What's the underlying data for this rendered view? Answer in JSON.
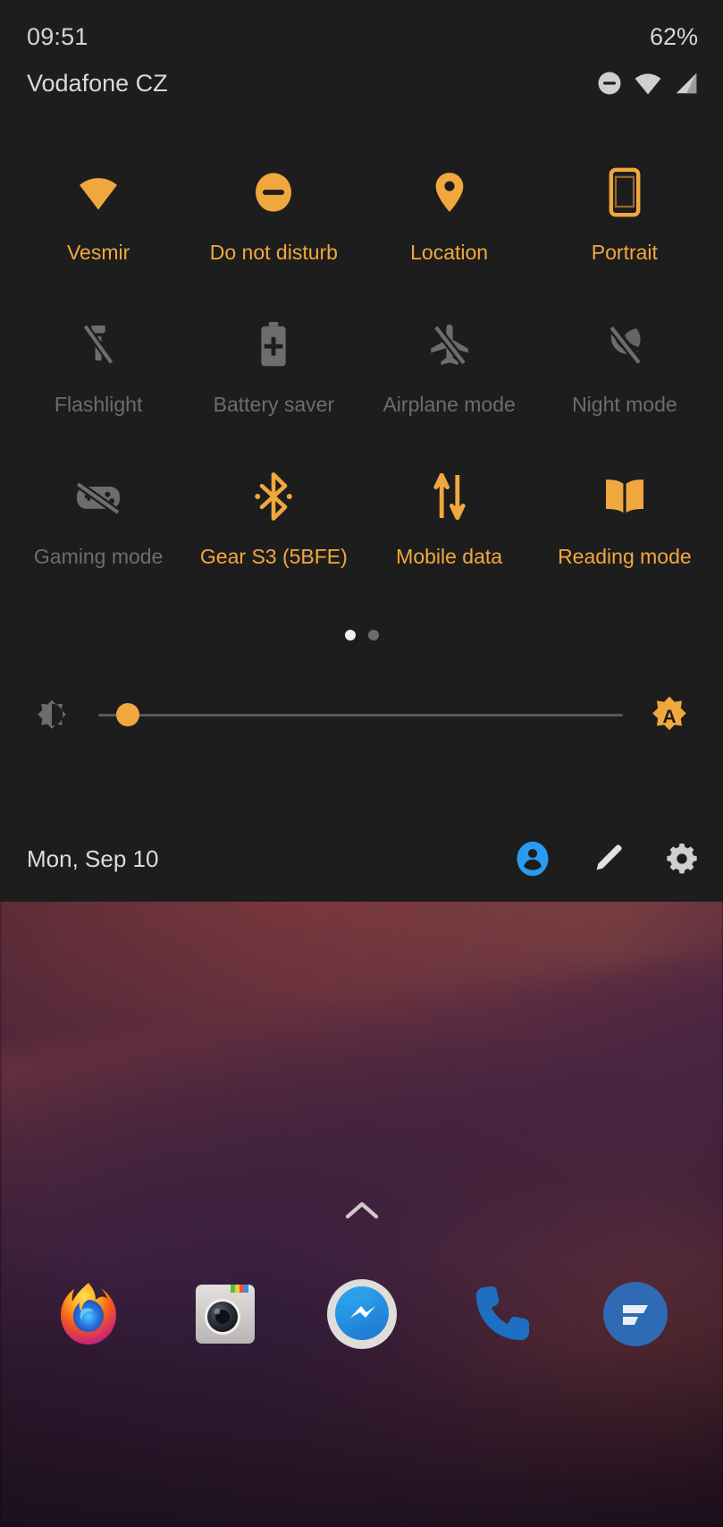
{
  "status_bar": {
    "clock": "09:51",
    "battery": "62%",
    "carrier": "Vodafone CZ",
    "icons": [
      "do-not-disturb-icon",
      "wifi-icon",
      "signal-icon"
    ]
  },
  "quick_settings": {
    "tiles": [
      [
        {
          "label": "Vesmir",
          "icon": "wifi-icon",
          "state": "on"
        },
        {
          "label": "Do not disturb",
          "icon": "do-not-disturb-icon",
          "state": "on"
        },
        {
          "label": "Location",
          "icon": "location-pin-icon",
          "state": "on"
        },
        {
          "label": "Portrait",
          "icon": "rotation-phone-icon",
          "state": "on"
        }
      ],
      [
        {
          "label": "Flashlight",
          "icon": "flashlight-off-icon",
          "state": "off"
        },
        {
          "label": "Battery saver",
          "icon": "battery-plus-icon",
          "state": "off"
        },
        {
          "label": "Airplane mode",
          "icon": "airplane-off-icon",
          "state": "off"
        },
        {
          "label": "Night mode",
          "icon": "moon-off-icon",
          "state": "off"
        }
      ],
      [
        {
          "label": "Gaming mode",
          "icon": "gamepad-off-icon",
          "state": "off"
        },
        {
          "label": "Gear S3 (5BFE)",
          "icon": "bluetooth-icon",
          "state": "on"
        },
        {
          "label": "Mobile data",
          "icon": "data-arrows-icon",
          "state": "on"
        },
        {
          "label": "Reading mode",
          "icon": "open-book-icon",
          "state": "on"
        }
      ]
    ],
    "pages": {
      "count": 2,
      "active_index": 0
    },
    "brightness": {
      "value_percent": 5,
      "left_icon": "brightness-icon",
      "right_icon": "auto-brightness-icon"
    },
    "footer": {
      "date": "Mon, Sep 10",
      "actions": [
        "user-avatar-icon",
        "edit-pencil-icon",
        "settings-gear-icon"
      ]
    }
  },
  "home_screen": {
    "app_drawer_handle": "chevron-up-icon",
    "dock": [
      {
        "name": "Firefox",
        "icon": "firefox-icon"
      },
      {
        "name": "Camera",
        "icon": "camera-icon"
      },
      {
        "name": "Messenger",
        "icon": "messenger-icon"
      },
      {
        "name": "Phone",
        "icon": "phone-icon"
      },
      {
        "name": "Flamingo",
        "icon": "flamingo-icon"
      }
    ]
  },
  "colors": {
    "accent_on": "#f0a83e",
    "label_off": "#6d6d6d",
    "panel_bg": "#1e1d1d",
    "text_primary": "#d9d9d9",
    "avatar_blue": "#2a9bf0"
  }
}
